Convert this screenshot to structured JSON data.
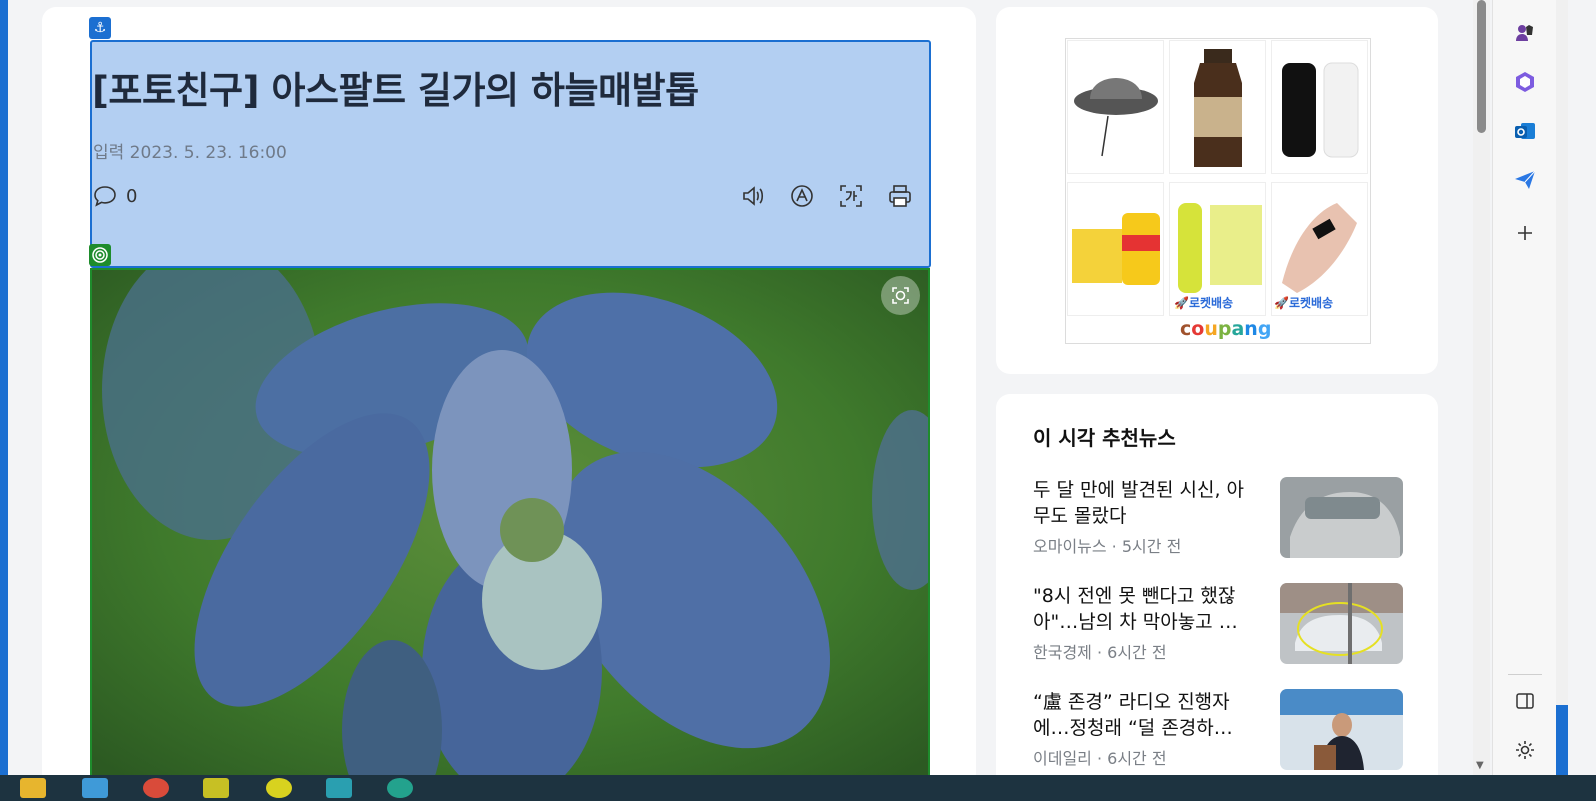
{
  "article": {
    "title": "[포토친구] 아스팔트 길가의 하늘매발톱",
    "pubdate": "입력 2023. 5. 23. 16:00",
    "comment_count": "0"
  },
  "ad": {
    "brand": "coupang",
    "badge_1": "🚀로켓배송",
    "badge_2": "🚀로켓배송"
  },
  "recommended": {
    "heading": "이 시각 추천뉴스",
    "items": [
      {
        "title": "두 달 만에 발견된 시신, 아무도 몰랐다",
        "meta": "오마이뉴스 · 5시간 전"
      },
      {
        "title": "\"8시 전엔 못 뺀다고 했잖아\"…남의 차 막아놓고 …",
        "meta": "한국경제 · 6시간 전"
      },
      {
        "title": "“盧 존경” 라디오 진행자에…정청래 “덜 존경하…",
        "meta": "이데일리 · 6시간 전"
      }
    ]
  },
  "colors": {
    "selection_blue": "#1b6fd1",
    "selection_fill": "#b3cff2",
    "image_frame_green": "#1e8c2c"
  }
}
